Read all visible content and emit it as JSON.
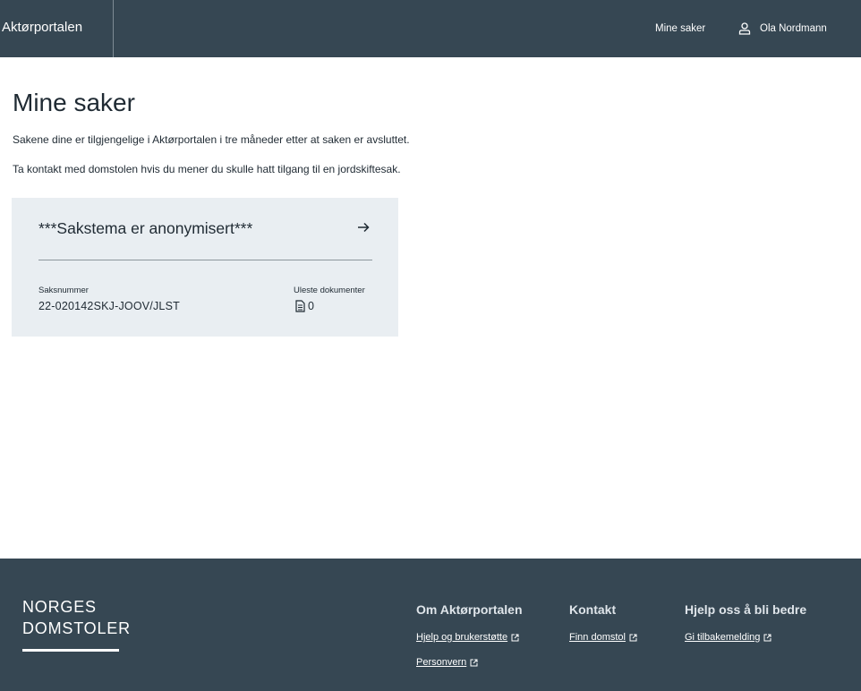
{
  "header": {
    "brand": "Aktørportalen",
    "nav_mine_saker": "Mine saker",
    "user_name": "Ola Nordmann"
  },
  "main": {
    "title": "Mine saker",
    "intro_1": "Sakene dine er tilgjengelige i Aktørportalen i tre måneder etter at saken er avsluttet.",
    "intro_2": "Ta kontakt med domstolen hvis du mener du skulle hatt tilgang til en jordskiftesak."
  },
  "case_card": {
    "title": "***Sakstema er anonymisert***",
    "case_number_label": "Saksnummer",
    "case_number": "22-020142SKJ-JOOV/JLST",
    "unread_label": "Uleste dokumenter",
    "unread_count": "0"
  },
  "footer": {
    "logo_line1": "NORGES",
    "logo_line2": "DOMSTOLER",
    "col1_title": "Om Aktørportalen",
    "col1_link1": "Hjelp og brukerstøtte",
    "col1_link2": "Personvern",
    "col2_title": "Kontakt",
    "col2_link1": "Finn domstol",
    "col3_title": "Hjelp oss å bli bedre",
    "col3_link1": "Gi tilbakemelding"
  },
  "colors": {
    "header_bg": "#364753",
    "card_bg": "#e9eef2",
    "text": "#1f2a33"
  },
  "icons": {
    "user": "user-icon",
    "arrow": "arrow-right-icon",
    "document": "document-icon",
    "external": "external-link-icon"
  }
}
